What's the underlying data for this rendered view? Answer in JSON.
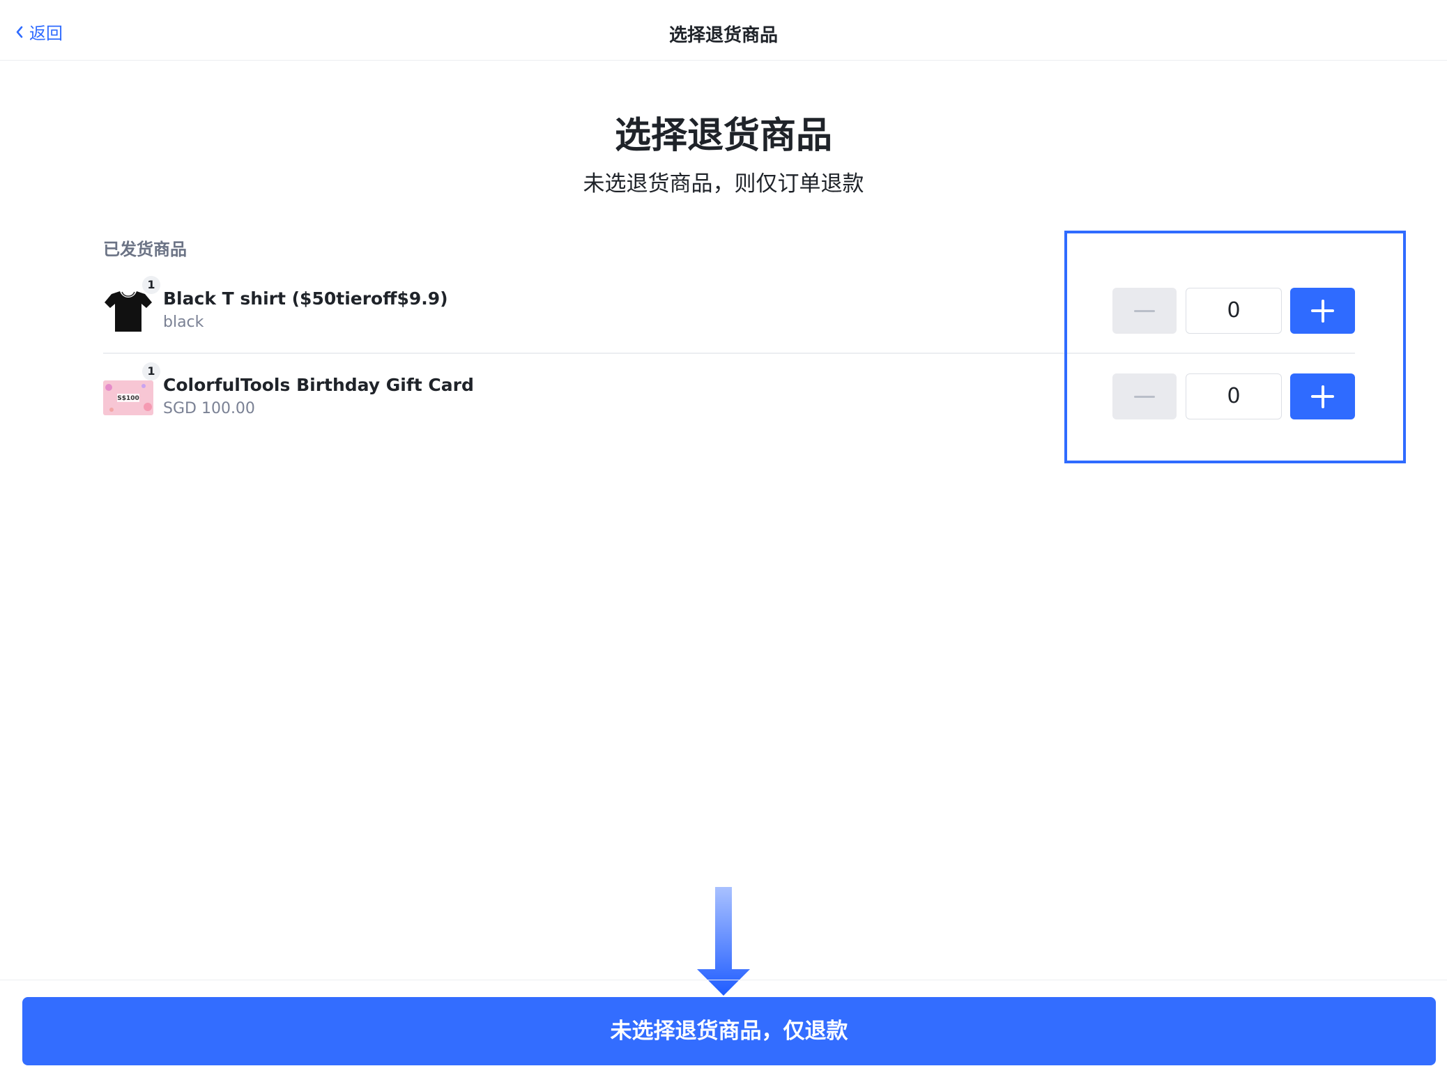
{
  "header": {
    "back_label": "返回",
    "title": "选择退货商品"
  },
  "main": {
    "title": "选择退货商品",
    "subtitle": "未选退货商品，则仅订单退款",
    "section_label": "已发货商品",
    "items": [
      {
        "badge": "1",
        "name": "Black T shirt ($50tieroff$9.9)",
        "sub": "black",
        "thumb_icon": "black-tshirt",
        "return_qty": "0"
      },
      {
        "badge": "1",
        "name": "ColorfulTools Birthday Gift Card",
        "sub": "SGD 100.00",
        "thumb_icon": "gift-card",
        "thumb_text": "S$100",
        "return_qty": "0"
      }
    ]
  },
  "footer": {
    "cta_label": "未选择退货商品，仅退款"
  },
  "colors": {
    "accent": "#2f6bff",
    "cta": "#336dff",
    "muted_text": "#7a8194",
    "stepper_disabled": "#e9eaee"
  }
}
